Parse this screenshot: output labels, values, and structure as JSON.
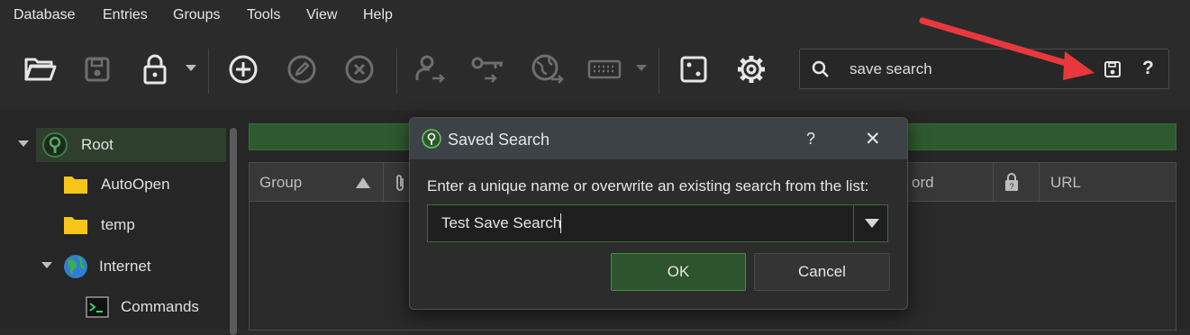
{
  "menu": [
    "Database",
    "Entries",
    "Groups",
    "Tools",
    "View",
    "Help"
  ],
  "toolbar": {
    "icons": [
      "folder-open-icon",
      "save-icon",
      "lock-icon",
      "add-icon",
      "edit-icon",
      "delete-icon",
      "copy-username-icon",
      "copy-password-icon",
      "open-url-icon",
      "autotype-icon",
      "dice-icon",
      "settings-icon"
    ]
  },
  "search": {
    "value": "save search",
    "help": "?"
  },
  "tree": {
    "items": [
      {
        "label": "Root",
        "icon": "root-icon"
      },
      {
        "label": "AutoOpen",
        "icon": "folder-icon"
      },
      {
        "label": "temp",
        "icon": "folder-icon"
      },
      {
        "label": "Internet",
        "icon": "globe-icon"
      },
      {
        "label": "Commands",
        "icon": "terminal-icon"
      }
    ]
  },
  "table": {
    "columns": [
      "Group",
      "ord",
      "URL"
    ]
  },
  "dialog": {
    "title": "Saved Search",
    "help": "?",
    "close": "✕",
    "message": "Enter a unique name or overwrite an existing search from the list:",
    "combo_value": "Test Save Search",
    "ok_label": "OK",
    "cancel_label": "Cancel"
  },
  "colors": {
    "accent": "#2e542e",
    "banner": "#2f5a2f",
    "arrow": "#e8383d"
  }
}
